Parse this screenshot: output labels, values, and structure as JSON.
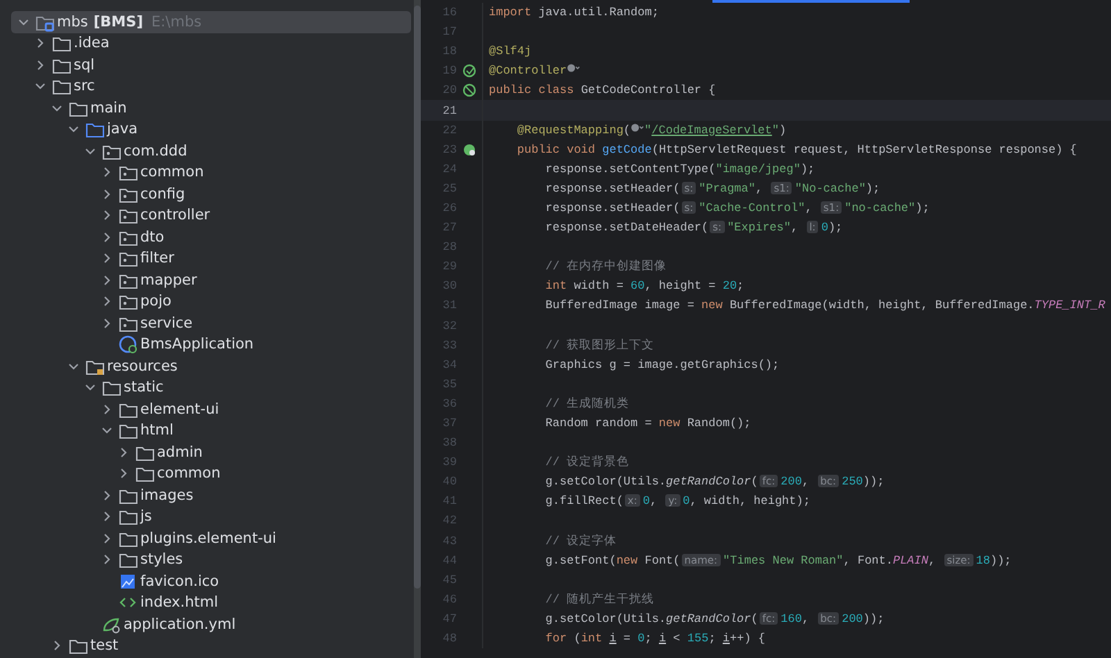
{
  "project_tree": {
    "root": {
      "name": "mbs",
      "module": "[BMS]",
      "path": "E:\\mbs",
      "kind": "project",
      "expanded": true,
      "selected": true,
      "children": [
        {
          "name": ".idea",
          "kind": "folder",
          "expanded": false,
          "selected": false
        },
        {
          "name": "sql",
          "kind": "folder",
          "expanded": false,
          "selected": false
        },
        {
          "name": "src",
          "kind": "folder",
          "expanded": true,
          "selected": false,
          "children": [
            {
              "name": "main",
              "kind": "folder",
              "expanded": true,
              "selected": false,
              "children": [
                {
                  "name": "java",
                  "kind": "source",
                  "expanded": true,
                  "selected": false,
                  "children": [
                    {
                      "name": "com.ddd",
                      "kind": "package",
                      "expanded": true,
                      "selected": false,
                      "children": [
                        {
                          "name": "common",
                          "kind": "package",
                          "expanded": false,
                          "selected": false
                        },
                        {
                          "name": "config",
                          "kind": "package",
                          "expanded": false,
                          "selected": false
                        },
                        {
                          "name": "controller",
                          "kind": "package",
                          "expanded": false,
                          "selected": false
                        },
                        {
                          "name": "dto",
                          "kind": "package",
                          "expanded": false,
                          "selected": false
                        },
                        {
                          "name": "filter",
                          "kind": "package",
                          "expanded": false,
                          "selected": false
                        },
                        {
                          "name": "mapper",
                          "kind": "package",
                          "expanded": false,
                          "selected": false
                        },
                        {
                          "name": "pojo",
                          "kind": "package",
                          "expanded": false,
                          "selected": false
                        },
                        {
                          "name": "service",
                          "kind": "package",
                          "expanded": false,
                          "selected": false
                        },
                        {
                          "name": "BmsApplication",
                          "kind": "spring-class",
                          "selected": false
                        }
                      ]
                    }
                  ]
                },
                {
                  "name": "resources",
                  "kind": "resources",
                  "expanded": true,
                  "selected": false,
                  "children": [
                    {
                      "name": "static",
                      "kind": "folder",
                      "expanded": true,
                      "selected": false,
                      "children": [
                        {
                          "name": "element-ui",
                          "kind": "folder",
                          "expanded": false,
                          "selected": false
                        },
                        {
                          "name": "html",
                          "kind": "folder",
                          "expanded": true,
                          "selected": false,
                          "children": [
                            {
                              "name": "admin",
                              "kind": "folder",
                              "expanded": false,
                              "selected": false
                            },
                            {
                              "name": "common",
                              "kind": "folder",
                              "expanded": false,
                              "selected": false
                            }
                          ]
                        },
                        {
                          "name": "images",
                          "kind": "folder",
                          "expanded": false,
                          "selected": false
                        },
                        {
                          "name": "js",
                          "kind": "folder",
                          "expanded": false,
                          "selected": false
                        },
                        {
                          "name": "plugins.element-ui",
                          "kind": "folder",
                          "expanded": false,
                          "selected": false
                        },
                        {
                          "name": "styles",
                          "kind": "folder",
                          "expanded": false,
                          "selected": false
                        },
                        {
                          "name": "favicon.ico",
                          "kind": "image-file",
                          "selected": false
                        },
                        {
                          "name": "index.html",
                          "kind": "html-file",
                          "selected": false
                        }
                      ]
                    },
                    {
                      "name": "application.yml",
                      "kind": "yml-file",
                      "selected": false
                    }
                  ]
                }
              ]
            },
            {
              "name": "test",
              "kind": "folder",
              "expanded": false,
              "selected": false
            }
          ]
        }
      ]
    }
  },
  "editor": {
    "lines": [
      {
        "number": "16",
        "kind": "plain",
        "current": false,
        "tokens": [
          {
            "kind": "kw",
            "text": "import"
          },
          {
            "kind": "plain",
            "text": " java.util.Random;"
          }
        ]
      },
      {
        "number": "17",
        "kind": "plain",
        "current": false
      },
      {
        "number": "18",
        "kind": "plain",
        "current": false,
        "tokens": [
          {
            "kind": "ann",
            "text": "@Slf4j"
          }
        ]
      },
      {
        "number": "19",
        "kind": "bean",
        "current": false,
        "tokens": [
          {
            "kind": "ann",
            "text": "@Controller"
          },
          {
            "kind": "globe"
          }
        ]
      },
      {
        "number": "20",
        "kind": "bean-class",
        "current": false,
        "tokens": [
          {
            "kind": "kw",
            "text": "public class"
          },
          {
            "kind": "plain",
            "text": " GetCodeController {"
          }
        ]
      },
      {
        "number": "21",
        "kind": "plain",
        "current": true
      },
      {
        "number": "22",
        "kind": "plain",
        "current": false,
        "tokens": [
          {
            "kind": "ann",
            "text": "    @RequestMapping"
          },
          {
            "kind": "plain",
            "text": "("
          },
          {
            "kind": "globe"
          },
          {
            "kind": "str",
            "text": "\""
          },
          {
            "kind": "link",
            "text": "/CodeImageServlet"
          },
          {
            "kind": "str",
            "text": "\""
          },
          {
            "kind": "plain",
            "text": ")"
          }
        ]
      },
      {
        "number": "23",
        "kind": "endpoint",
        "current": false,
        "tokens": [
          {
            "kind": "kw",
            "text": "    public void "
          },
          {
            "kind": "decl",
            "text": "getCode"
          },
          {
            "kind": "plain",
            "text": "(HttpServletRequest request, HttpServletResponse response) {"
          }
        ]
      },
      {
        "number": "24",
        "kind": "plain",
        "current": false,
        "tokens": [
          {
            "kind": "plain",
            "text": "        response.setContentType("
          },
          {
            "kind": "str",
            "text": "\"image/jpeg\""
          },
          {
            "kind": "plain",
            "text": ");"
          }
        ]
      },
      {
        "number": "25",
        "kind": "plain",
        "current": false,
        "tokens": [
          {
            "kind": "plain",
            "text": "        response.setHeader("
          },
          {
            "kind": "hint",
            "text": "s:"
          },
          {
            "kind": "str",
            "text": "\"Pragma\""
          },
          {
            "kind": "plain",
            "text": ", "
          },
          {
            "kind": "hint",
            "text": "s1:"
          },
          {
            "kind": "str",
            "text": "\"No-cache\""
          },
          {
            "kind": "plain",
            "text": ");"
          }
        ]
      },
      {
        "number": "26",
        "kind": "plain",
        "current": false,
        "tokens": [
          {
            "kind": "plain",
            "text": "        response.setHeader("
          },
          {
            "kind": "hint",
            "text": "s:"
          },
          {
            "kind": "str",
            "text": "\"Cache-Control\""
          },
          {
            "kind": "plain",
            "text": ", "
          },
          {
            "kind": "hint",
            "text": "s1:"
          },
          {
            "kind": "str",
            "text": "\"no-cache\""
          },
          {
            "kind": "plain",
            "text": ");"
          }
        ]
      },
      {
        "number": "27",
        "kind": "plain",
        "current": false,
        "tokens": [
          {
            "kind": "plain",
            "text": "        response.setDateHeader("
          },
          {
            "kind": "hint",
            "text": "s:"
          },
          {
            "kind": "str",
            "text": "\"Expires\""
          },
          {
            "kind": "plain",
            "text": ", "
          },
          {
            "kind": "hint",
            "text": "l:"
          },
          {
            "kind": "num",
            "text": "0"
          },
          {
            "kind": "plain",
            "text": ");"
          }
        ]
      },
      {
        "number": "28",
        "kind": "plain",
        "current": false
      },
      {
        "number": "29",
        "kind": "plain",
        "current": false,
        "tokens": [
          {
            "kind": "com",
            "text": "        // 在内存中创建图像"
          }
        ]
      },
      {
        "number": "30",
        "kind": "plain",
        "current": false,
        "tokens": [
          {
            "kind": "kw",
            "text": "        int"
          },
          {
            "kind": "plain",
            "text": " width = "
          },
          {
            "kind": "num",
            "text": "60"
          },
          {
            "kind": "plain",
            "text": ", height = "
          },
          {
            "kind": "num",
            "text": "20"
          },
          {
            "kind": "plain",
            "text": ";"
          }
        ]
      },
      {
        "number": "31",
        "kind": "plain",
        "current": false,
        "tokens": [
          {
            "kind": "plain",
            "text": "        BufferedImage image = "
          },
          {
            "kind": "kw",
            "text": "new"
          },
          {
            "kind": "plain",
            "text": " BufferedImage(width, height, BufferedImage."
          },
          {
            "kind": "static",
            "text": "TYPE_INT_R"
          }
        ]
      },
      {
        "number": "32",
        "kind": "plain",
        "current": false
      },
      {
        "number": "33",
        "kind": "plain",
        "current": false,
        "tokens": [
          {
            "kind": "com",
            "text": "        // 获取图形上下文"
          }
        ]
      },
      {
        "number": "34",
        "kind": "plain",
        "current": false,
        "tokens": [
          {
            "kind": "plain",
            "text": "        Graphics g = image.getGraphics();"
          }
        ]
      },
      {
        "number": "35",
        "kind": "plain",
        "current": false
      },
      {
        "number": "36",
        "kind": "plain",
        "current": false,
        "tokens": [
          {
            "kind": "com",
            "text": "        // 生成随机类"
          }
        ]
      },
      {
        "number": "37",
        "kind": "plain",
        "current": false,
        "tokens": [
          {
            "kind": "plain",
            "text": "        Random random = "
          },
          {
            "kind": "kw",
            "text": "new"
          },
          {
            "kind": "plain",
            "text": " Random();"
          }
        ]
      },
      {
        "number": "38",
        "kind": "plain",
        "current": false
      },
      {
        "number": "39",
        "kind": "plain",
        "current": false,
        "tokens": [
          {
            "kind": "com",
            "text": "        // 设定背景色"
          }
        ]
      },
      {
        "number": "40",
        "kind": "plain",
        "current": false,
        "tokens": [
          {
            "kind": "plain",
            "text": "        g.setColor(Utils."
          },
          {
            "kind": "italic",
            "text": "getRandColor"
          },
          {
            "kind": "plain",
            "text": "("
          },
          {
            "kind": "hint",
            "text": "fc:"
          },
          {
            "kind": "num",
            "text": "200"
          },
          {
            "kind": "plain",
            "text": ", "
          },
          {
            "kind": "hint",
            "text": "bc:"
          },
          {
            "kind": "num",
            "text": "250"
          },
          {
            "kind": "plain",
            "text": "));"
          }
        ]
      },
      {
        "number": "41",
        "kind": "plain",
        "current": false,
        "tokens": [
          {
            "kind": "plain",
            "text": "        g.fillRect("
          },
          {
            "kind": "hint",
            "text": "x:"
          },
          {
            "kind": "num",
            "text": "0"
          },
          {
            "kind": "plain",
            "text": ", "
          },
          {
            "kind": "hint",
            "text": "y:"
          },
          {
            "kind": "num",
            "text": "0"
          },
          {
            "kind": "plain",
            "text": ", width, height);"
          }
        ]
      },
      {
        "number": "42",
        "kind": "plain",
        "current": false
      },
      {
        "number": "43",
        "kind": "plain",
        "current": false,
        "tokens": [
          {
            "kind": "com",
            "text": "        // 设定字体"
          }
        ]
      },
      {
        "number": "44",
        "kind": "plain",
        "current": false,
        "tokens": [
          {
            "kind": "plain",
            "text": "        g.setFont("
          },
          {
            "kind": "kw",
            "text": "new"
          },
          {
            "kind": "plain",
            "text": " Font("
          },
          {
            "kind": "hint",
            "text": "name:"
          },
          {
            "kind": "str",
            "text": "\"Times New Roman\""
          },
          {
            "kind": "plain",
            "text": ", Font."
          },
          {
            "kind": "static",
            "text": "PLAIN"
          },
          {
            "kind": "plain",
            "text": ", "
          },
          {
            "kind": "hint",
            "text": "size:"
          },
          {
            "kind": "num",
            "text": "18"
          },
          {
            "kind": "plain",
            "text": "));"
          }
        ]
      },
      {
        "number": "45",
        "kind": "plain",
        "current": false
      },
      {
        "number": "46",
        "kind": "plain",
        "current": false,
        "tokens": [
          {
            "kind": "com",
            "text": "        // 随机产生干扰线"
          }
        ]
      },
      {
        "number": "47",
        "kind": "plain",
        "current": false,
        "tokens": [
          {
            "kind": "plain",
            "text": "        g.setColor(Utils."
          },
          {
            "kind": "italic",
            "text": "getRandColor"
          },
          {
            "kind": "plain",
            "text": "("
          },
          {
            "kind": "hint",
            "text": "fc:"
          },
          {
            "kind": "num",
            "text": "160"
          },
          {
            "kind": "plain",
            "text": ", "
          },
          {
            "kind": "hint",
            "text": "bc:"
          },
          {
            "kind": "num",
            "text": "200"
          },
          {
            "kind": "plain",
            "text": "));"
          }
        ]
      },
      {
        "number": "48",
        "kind": "plain",
        "current": false,
        "tokens": [
          {
            "kind": "kw",
            "text": "        for"
          },
          {
            "kind": "plain",
            "text": " ("
          },
          {
            "kind": "kw",
            "text": "int "
          },
          {
            "kind": "var",
            "text": "i"
          },
          {
            "kind": "plain",
            "text": " = "
          },
          {
            "kind": "num",
            "text": "0"
          },
          {
            "kind": "plain",
            "text": "; "
          },
          {
            "kind": "var",
            "text": "i"
          },
          {
            "kind": "plain",
            "text": " < "
          },
          {
            "kind": "num",
            "text": "155"
          },
          {
            "kind": "plain",
            "text": "; "
          },
          {
            "kind": "var",
            "text": "i"
          },
          {
            "kind": "plain",
            "text": "++) {"
          }
        ]
      }
    ]
  }
}
